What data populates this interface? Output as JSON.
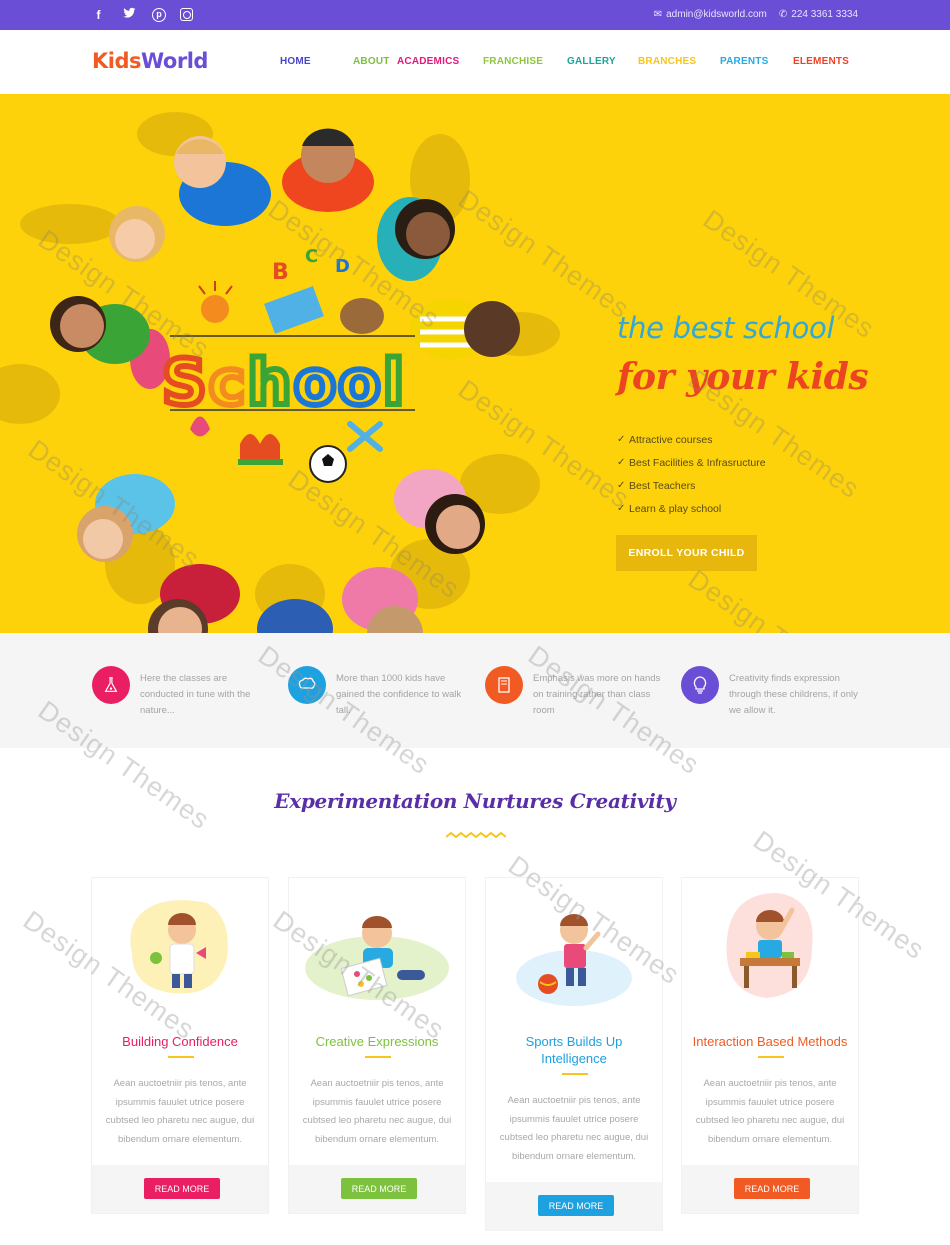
{
  "topbar": {
    "social": [
      "facebook-icon",
      "twitter-icon",
      "pinterest-icon",
      "instagram-icon"
    ],
    "email": "admin@kidsworld.com",
    "phone": "224 3361 3334"
  },
  "brand": {
    "part1": "Kids",
    "part2": "World"
  },
  "nav": [
    {
      "label": "HOME",
      "color": "#4a45c9"
    },
    {
      "label": "ABOUT",
      "color": "#7cc23f"
    },
    {
      "label": "ACADEMICS",
      "color": "#e2197a"
    },
    {
      "label": "FRANCHISE",
      "color": "#8dc63f"
    },
    {
      "label": "GALLERY",
      "color": "#1da59a"
    },
    {
      "label": "BRANCHES",
      "color": "#f8c51c"
    },
    {
      "label": "PARENTS",
      "color": "#27aae1"
    },
    {
      "label": "ELEMENTS",
      "color": "#ef4123"
    }
  ],
  "hero": {
    "school_word": "School",
    "tagline_line1": "the best school",
    "tagline_line2": "for your kids",
    "features": [
      "Attractive courses",
      "Best Facilities & Infrasructure",
      "Best Teachers",
      "Learn & play school"
    ],
    "cta": "ENROLL YOUR CHILD"
  },
  "strip": [
    {
      "icon": "flask-icon",
      "color": "#e91e63",
      "text": "Here the classes are conducted in tune with the nature..."
    },
    {
      "icon": "brain-icon",
      "color": "#1da1e0",
      "text": "More than 1000 kids have gained the confidence to walk tall."
    },
    {
      "icon": "book-icon",
      "color": "#f15a22",
      "text": "Emphasis was more on hands on training rather than class room"
    },
    {
      "icon": "light-bulb-icon",
      "color": "#6a4ed6",
      "text": "Creativity finds expression through these childrens, if only we allow it."
    }
  ],
  "section_title": "Experimentation Nurtures Creativity",
  "cards": [
    {
      "title": "Building Confidence",
      "color": "#e91e63",
      "desc": "Aean auctoetniir pis tenos, ante ipsummis fauulet utrice posere cubtsed leo pharetu nec augue, dui bibendum ornare elementum.",
      "button": "READ MORE"
    },
    {
      "title": "Creative Expressions",
      "color": "#7cc23f",
      "desc": "Aean auctoetniir pis tenos, ante ipsummis fauulet utrice posere cubtsed leo pharetu nec augue, dui bibendum ornare elementum.",
      "button": "READ MORE"
    },
    {
      "title": "Sports Builds Up Intelligence",
      "color": "#1da1e0",
      "desc": "Aean auctoetniir pis tenos, ante ipsummis fauulet utrice posere cubtsed leo pharetu nec augue, dui bibendum ornare elementum.",
      "button": "READ MORE"
    },
    {
      "title": "Interaction Based Methods",
      "color": "#f15a22",
      "desc": "Aean auctoetniir pis tenos, ante ipsummis fauulet utrice posere cubtsed leo pharetu nec augue, dui bibendum ornare elementum.",
      "button": "READ MORE"
    }
  ],
  "watermark": "Design Themes"
}
